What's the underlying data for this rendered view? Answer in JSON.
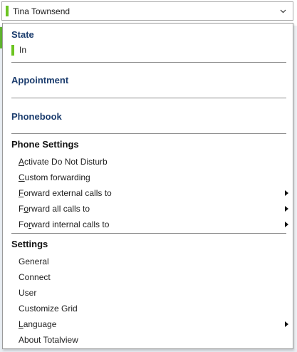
{
  "user_selector": {
    "name": "Tina Townsend",
    "status_color": "#6cc421",
    "icon": "chevron-down-icon"
  },
  "menu": {
    "state": {
      "title": "State",
      "current": "In",
      "color": "#6cc421"
    },
    "appointment": {
      "title": "Appointment"
    },
    "phonebook": {
      "title": "Phonebook"
    },
    "phone_settings": {
      "title": "Phone Settings",
      "items": [
        {
          "access": "A",
          "rest": "ctivate Do Not Disturb",
          "submenu": false
        },
        {
          "access": "C",
          "rest": "ustom forwarding",
          "submenu": false
        },
        {
          "access": "F",
          "rest": "orward external calls to",
          "submenu": true
        },
        {
          "pre": "F",
          "access": "o",
          "rest": "rward all calls to",
          "submenu": true
        },
        {
          "pre": "Fo",
          "access": "r",
          "rest": "ward internal calls to",
          "submenu": true
        }
      ]
    },
    "settings": {
      "title": "Settings",
      "items": [
        {
          "label": "General"
        },
        {
          "label": "Connect"
        },
        {
          "label": "User"
        },
        {
          "label": "Customize Grid"
        },
        {
          "access": "L",
          "rest": "anguage",
          "submenu": true
        },
        {
          "label": "About Totalview"
        }
      ]
    }
  },
  "colors": {
    "section_title": "#1c3d6e",
    "status_in": "#6cc421"
  }
}
